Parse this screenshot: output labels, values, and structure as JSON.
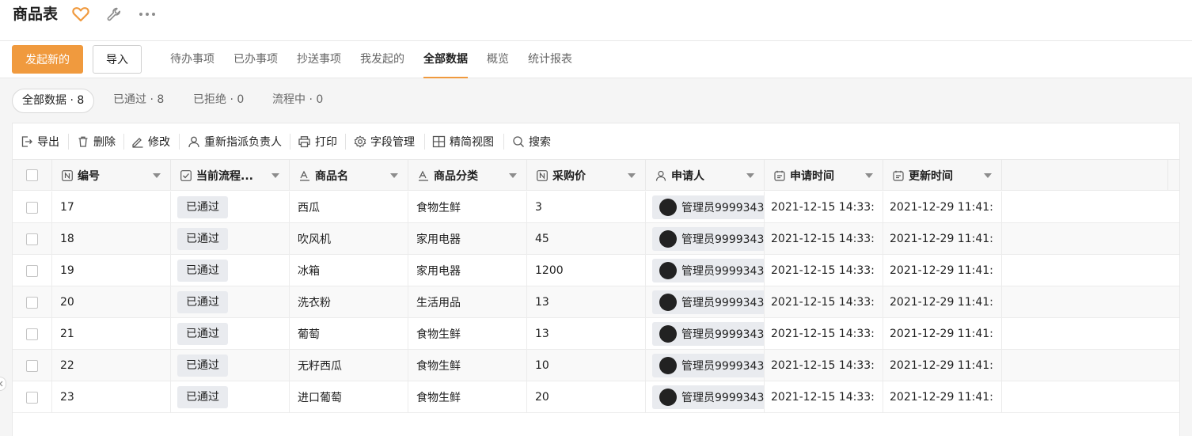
{
  "app": {
    "title": "商品表"
  },
  "actions": {
    "primary": "发起新的",
    "import": "导入"
  },
  "tabs": [
    {
      "label": "待办事项"
    },
    {
      "label": "已办事项"
    },
    {
      "label": "抄送事项"
    },
    {
      "label": "我发起的"
    },
    {
      "label": "全部数据",
      "active": true
    },
    {
      "label": "概览"
    },
    {
      "label": "统计报表"
    }
  ],
  "filters": [
    {
      "label": "全部数据 · 8",
      "active": true
    },
    {
      "label": "已通过 · 8"
    },
    {
      "label": "已拒绝 · 0"
    },
    {
      "label": "流程中 · 0"
    }
  ],
  "toolbar": [
    {
      "label": "导出",
      "icon": "export-icon"
    },
    {
      "label": "删除",
      "icon": "trash-icon"
    },
    {
      "label": "修改",
      "icon": "edit-icon"
    },
    {
      "label": "重新指派负责人",
      "icon": "user-icon"
    },
    {
      "label": "打印",
      "icon": "printer-icon"
    },
    {
      "label": "字段管理",
      "icon": "gear-icon"
    },
    {
      "label": "精简视图",
      "icon": "grid-icon"
    },
    {
      "label": "搜索",
      "icon": "search-icon"
    }
  ],
  "columns": [
    {
      "label": "编号",
      "icon": "number-field-icon"
    },
    {
      "label": "当前流程...",
      "icon": "checkbox-field-icon"
    },
    {
      "label": "商品名",
      "icon": "text-field-icon"
    },
    {
      "label": "商品分类",
      "icon": "text-field-icon"
    },
    {
      "label": "采购价",
      "icon": "number-field-icon"
    },
    {
      "label": "申请人",
      "icon": "person-field-icon"
    },
    {
      "label": "申请时间",
      "icon": "date-field-icon"
    },
    {
      "label": "更新时间",
      "icon": "date-field-icon"
    }
  ],
  "rows": [
    {
      "id": "17",
      "status": "已通过",
      "name": "西瓜",
      "category": "食物生鲜",
      "price": "3",
      "applicant": "管理员9999343",
      "apply_time": "2021-12-15 14:33:",
      "update_time": "2021-12-29 11:41:"
    },
    {
      "id": "18",
      "status": "已通过",
      "name": "吹风机",
      "category": "家用电器",
      "price": "45",
      "applicant": "管理员9999343",
      "apply_time": "2021-12-15 14:33:",
      "update_time": "2021-12-29 11:41:"
    },
    {
      "id": "19",
      "status": "已通过",
      "name": "冰箱",
      "category": "家用电器",
      "price": "1200",
      "applicant": "管理员9999343",
      "apply_time": "2021-12-15 14:33:",
      "update_time": "2021-12-29 11:41:"
    },
    {
      "id": "20",
      "status": "已通过",
      "name": "洗衣粉",
      "category": "生活用品",
      "price": "13",
      "applicant": "管理员9999343",
      "apply_time": "2021-12-15 14:33:",
      "update_time": "2021-12-29 11:41:"
    },
    {
      "id": "21",
      "status": "已通过",
      "name": "葡萄",
      "category": "食物生鲜",
      "price": "13",
      "applicant": "管理员9999343",
      "apply_time": "2021-12-15 14:33:",
      "update_time": "2021-12-29 11:41:"
    },
    {
      "id": "22",
      "status": "已通过",
      "name": "无籽西瓜",
      "category": "食物生鲜",
      "price": "10",
      "applicant": "管理员9999343",
      "apply_time": "2021-12-15 14:33:",
      "update_time": "2021-12-29 11:41:"
    },
    {
      "id": "23",
      "status": "已通过",
      "name": "进口葡萄",
      "category": "食物生鲜",
      "price": "20",
      "applicant": "管理员9999343",
      "apply_time": "2021-12-15 14:33:",
      "update_time": "2021-12-29 11:41:"
    }
  ],
  "colors": {
    "accent": "#f09a3e",
    "badge_bg": "#e9ebef"
  }
}
